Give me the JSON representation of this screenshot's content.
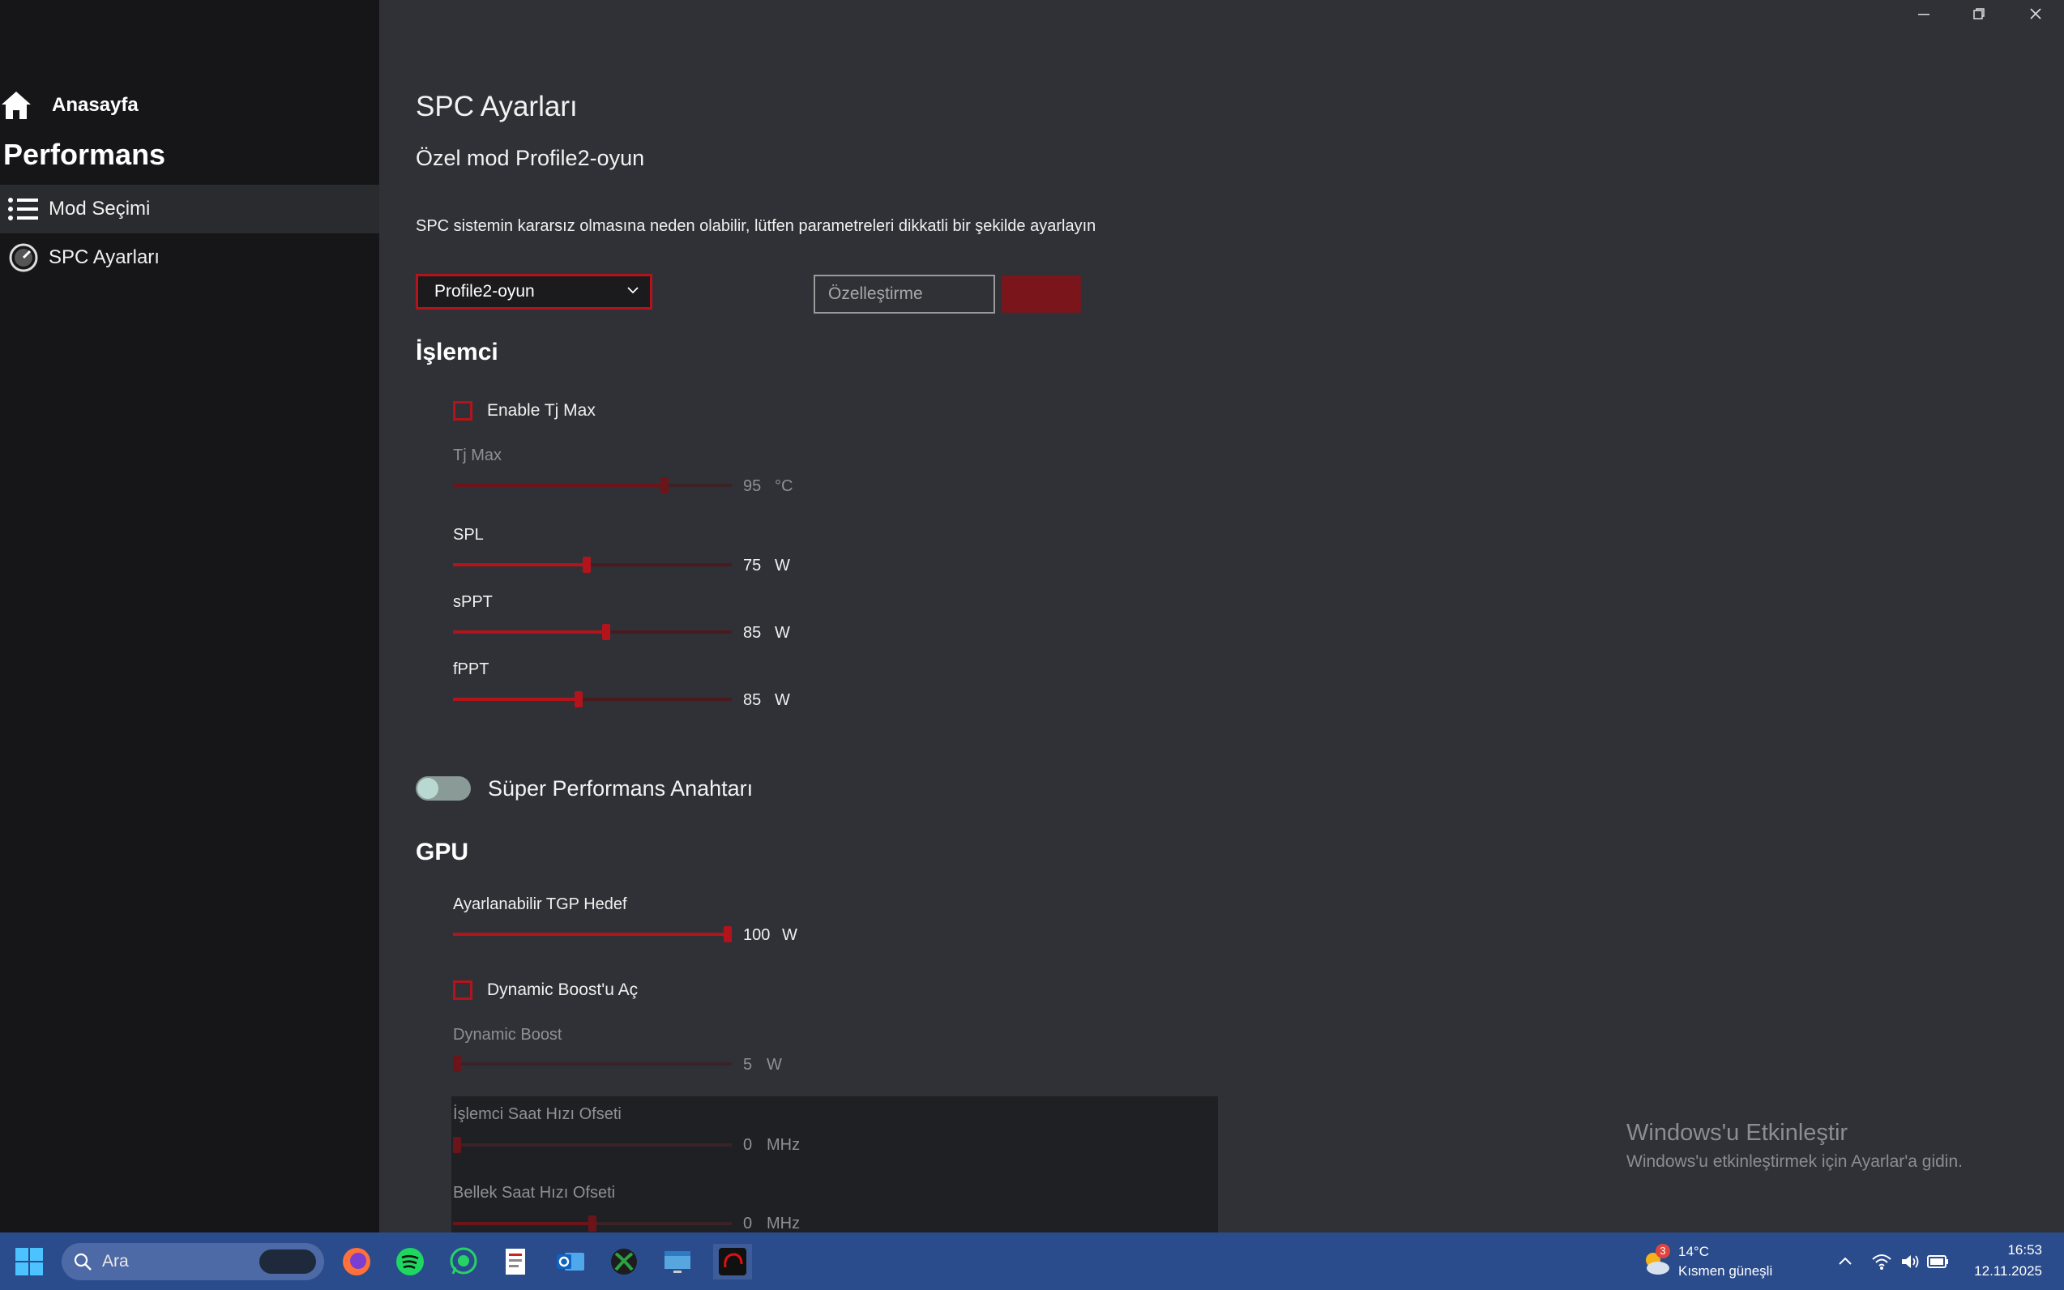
{
  "window": {
    "controls": [
      "minimize",
      "restore",
      "close"
    ]
  },
  "sidebar": {
    "home_label": "Anasayfa",
    "section_title": "Performans",
    "items": [
      {
        "label": "Mod Seçimi",
        "icon": "list-icon",
        "active": true
      },
      {
        "label": "SPC Ayarları",
        "icon": "gauge-icon",
        "active": false
      }
    ]
  },
  "main": {
    "title": "SPC Ayarları",
    "subtitle": "Özel mod Profile2-oyun",
    "warning": "SPC sistemin kararsız olmasına neden olabilir, lütfen parametreleri dikkatli bir şekilde ayarlayın",
    "profile_dropdown": {
      "selected": "Profile2-oyun"
    },
    "name_input": {
      "placeholder": "Özelleştirme"
    },
    "cpu": {
      "heading": "İşlemci",
      "enable_tjmax": {
        "label": "Enable Tj Max",
        "checked": false
      },
      "sliders": [
        {
          "name": "Tj Max",
          "value": "95",
          "unit": "°C",
          "fraction": 0.76,
          "disabled": true
        },
        {
          "name": "SPL",
          "value": "75",
          "unit": "W",
          "fraction": 0.48,
          "disabled": false
        },
        {
          "name": "sPPT",
          "value": "85",
          "unit": "W",
          "fraction": 0.55,
          "disabled": false
        },
        {
          "name": "fPPT",
          "value": "85",
          "unit": "W",
          "fraction": 0.45,
          "disabled": false
        }
      ]
    },
    "super_performance": {
      "label": "Süper Performans Anahtarı",
      "on": false
    },
    "gpu": {
      "heading": "GPU",
      "tgp": {
        "name": "Ayarlanabilir TGP Hedef",
        "value": "100",
        "unit": "W",
        "fraction": 1.0
      },
      "dynamic_boost_toggle": {
        "label": "Dynamic Boost'u Aç",
        "checked": false
      },
      "dynamic_boost": {
        "name": "Dynamic Boost",
        "value": "5",
        "unit": "W",
        "fraction": 0.0
      },
      "cpu_clock_offset": {
        "name": "İşlemci Saat Hızı Ofseti",
        "value": "0",
        "unit": "MHz",
        "fraction": 0.0
      },
      "mem_clock_offset": {
        "name": "Bellek Saat Hızı Ofseti",
        "value": "0",
        "unit": "MHz",
        "fraction": 0.5
      }
    },
    "activation_watermark": {
      "line1": "Windows'u Etkinleştir",
      "line2": "Windows'u etkinleştirmek için Ayarlar'a gidin."
    }
  },
  "taskbar": {
    "search_placeholder": "Ara",
    "pinned": [
      "firefox-icon",
      "spotify-icon",
      "whatsapp-icon",
      "notepad-icon",
      "outlook-icon",
      "xbox-icon",
      "remote-desktop-icon",
      "control-center-icon"
    ],
    "weather": {
      "badge": "3",
      "temp": "14°C",
      "desc": "Kısmen güneşli"
    },
    "clock": {
      "time": "16:53",
      "date": "12.11.2025"
    }
  },
  "colors": {
    "accent": "#b3141b",
    "background": "#2f3137",
    "sidebar": "#161618",
    "taskbar": "#2a4b8c"
  }
}
